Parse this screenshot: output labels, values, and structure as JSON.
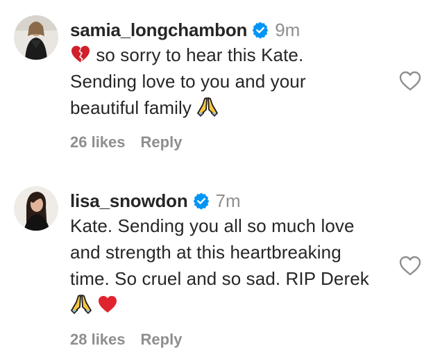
{
  "comments": [
    {
      "username": "samia_longchambon",
      "time": "9m",
      "lines": [
        "so sorry to hear this Kate.",
        "Sending love to you and your",
        "beautiful family"
      ],
      "likes": "26 likes",
      "reply": "Reply",
      "icons": [
        "broken-heart-emoji",
        "folded-hands-emoji",
        "verified-badge-icon",
        "heart-outline-icon"
      ]
    },
    {
      "username": "lisa_snowdon",
      "time": "7m",
      "lines": [
        "Kate. Sending you all so much love",
        "and strength at this heartbreaking",
        "time. So cruel and so sad. RIP Derek"
      ],
      "likes": "28 likes",
      "reply": "Reply",
      "icons": [
        "folded-hands-emoji",
        "red-heart-emoji",
        "verified-badge-icon",
        "heart-outline-icon"
      ]
    }
  ],
  "colors": {
    "text": "#262626",
    "muted": "#8e8e8e",
    "verified": "#0095f6",
    "heart": "#e0242f"
  }
}
